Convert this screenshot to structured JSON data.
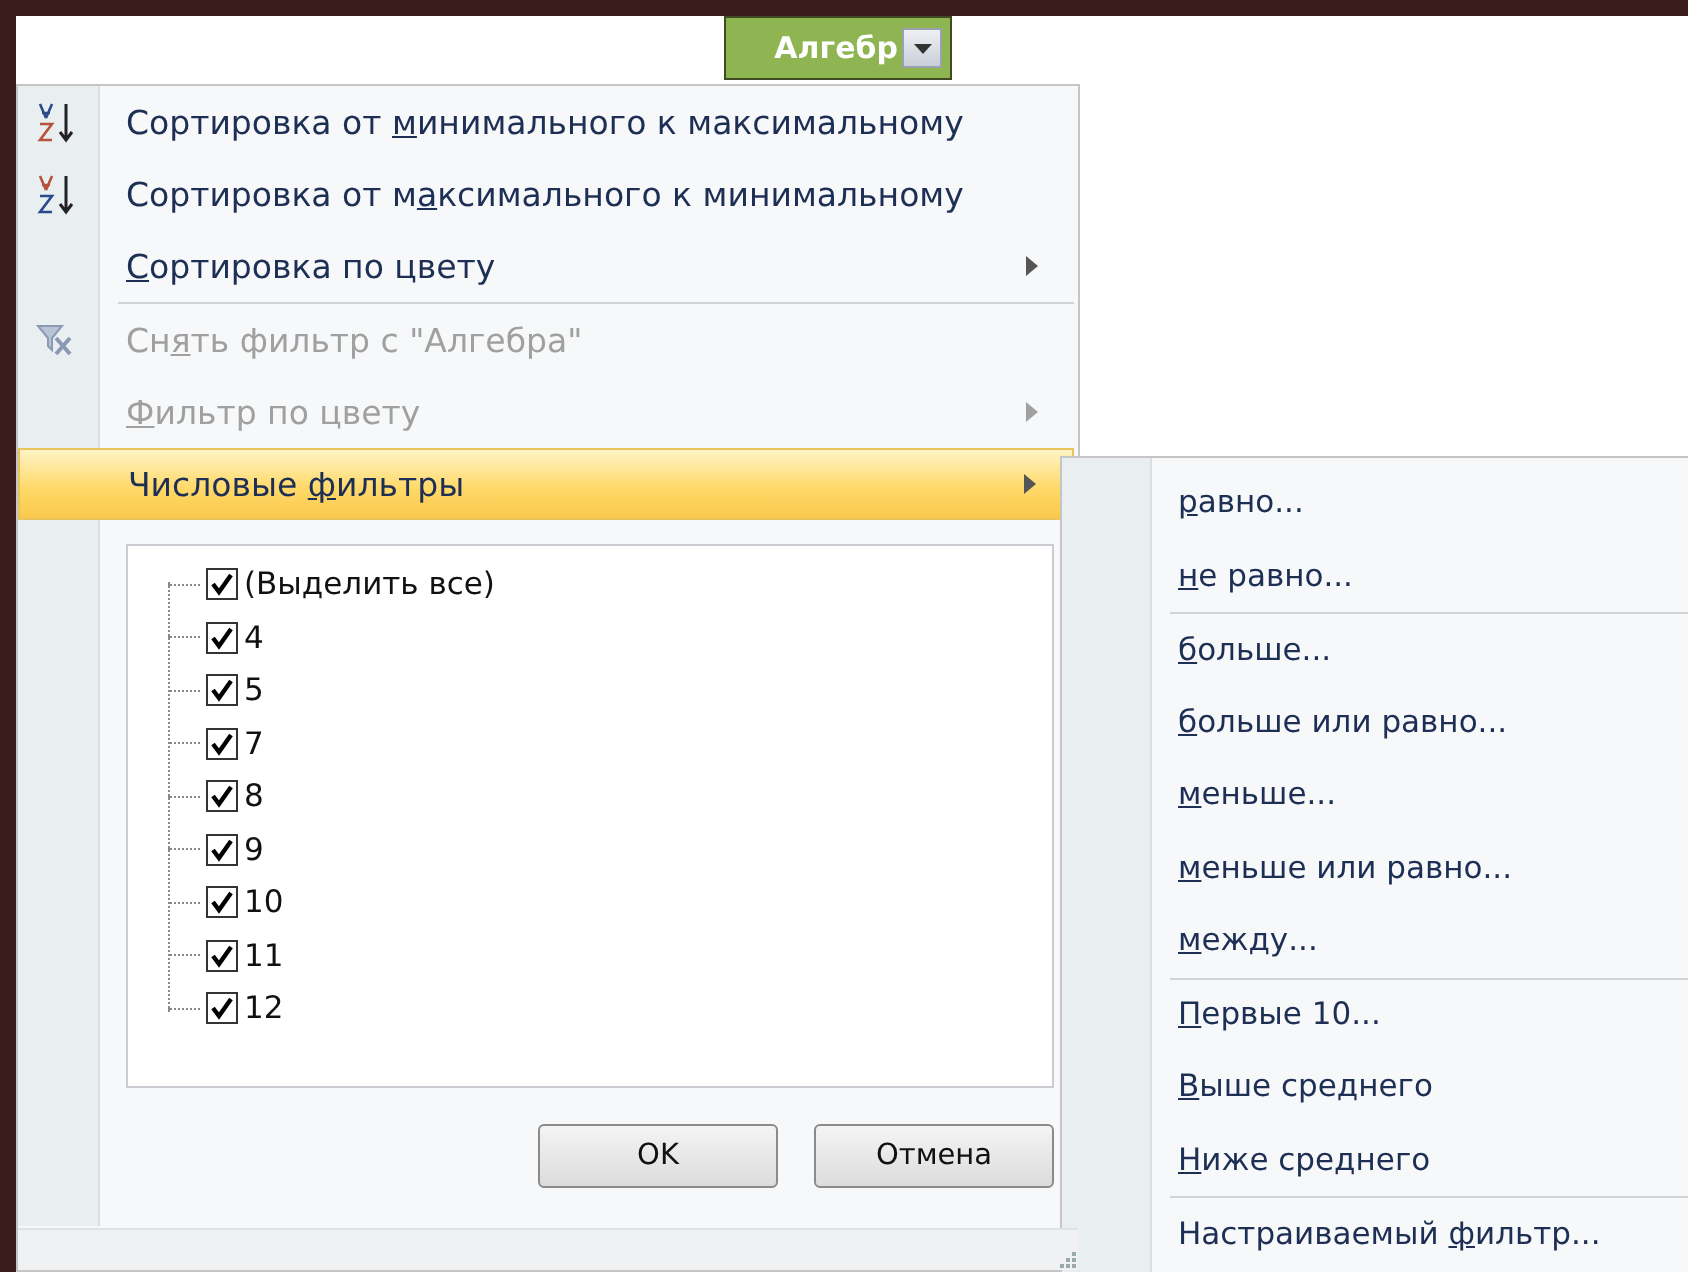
{
  "header_cell": {
    "label": "Алгебр"
  },
  "menu": {
    "items": [
      {
        "kind": "sort-asc",
        "label_parts": {
          "before": "Сортировка от ",
          "key": "м",
          "after": "инимального к максимальному"
        },
        "disabled": false,
        "submenu": false,
        "selected": false,
        "separator_before": false
      },
      {
        "kind": "sort-desc",
        "label_parts": {
          "before": "Сортировка от м",
          "key": "а",
          "after": "ксимального к минимальному"
        },
        "disabled": false,
        "submenu": false,
        "selected": false,
        "separator_before": false
      },
      {
        "kind": "plain",
        "label_parts": {
          "key": "С",
          "after": "ортировка по цвету"
        },
        "disabled": false,
        "submenu": true,
        "selected": false,
        "separator_before": false
      },
      {
        "kind": "clear-filter",
        "label_parts": {
          "before": "Сн",
          "key": "я",
          "after": "ть фильтр с \"Алгебра\""
        },
        "disabled": true,
        "submenu": false,
        "selected": false,
        "separator_before": true
      },
      {
        "kind": "plain",
        "label_parts": {
          "key": "Ф",
          "after": "ильтр по цвету"
        },
        "disabled": true,
        "submenu": true,
        "selected": false,
        "separator_before": false
      },
      {
        "kind": "plain",
        "label_parts": {
          "before": "Числовые ",
          "key": "ф",
          "after": "ильтры"
        },
        "disabled": false,
        "submenu": true,
        "selected": true,
        "separator_before": false
      }
    ]
  },
  "values": [
    {
      "label": "(Выделить все)",
      "checked": true
    },
    {
      "label": "4",
      "checked": true
    },
    {
      "label": "5",
      "checked": true
    },
    {
      "label": "7",
      "checked": true
    },
    {
      "label": "8",
      "checked": true
    },
    {
      "label": "9",
      "checked": true
    },
    {
      "label": "10",
      "checked": true
    },
    {
      "label": "11",
      "checked": true
    },
    {
      "label": "12",
      "checked": true
    }
  ],
  "buttons": [
    "OK",
    "Отмена"
  ],
  "submenu": {
    "items": [
      {
        "label_parts": {
          "key": "р",
          "after": "авно..."
        },
        "separator_before": false
      },
      {
        "label_parts": {
          "key": "н",
          "after": "е равно..."
        },
        "separator_before": false
      },
      {
        "label_parts": {
          "key": "б",
          "after": "ольше..."
        },
        "separator_before": true
      },
      {
        "label_parts": {
          "key": "б",
          "after": "ольше или равно..."
        },
        "separator_before": false
      },
      {
        "label_parts": {
          "key": "м",
          "after": "еньше..."
        },
        "separator_before": false
      },
      {
        "label_parts": {
          "key": "м",
          "after": "еньше или равно..."
        },
        "separator_before": false
      },
      {
        "label_parts": {
          "key": "м",
          "after": "ежду..."
        },
        "separator_before": false
      },
      {
        "label_parts": {
          "key": "П",
          "after": "ервые 10..."
        },
        "separator_before": true
      },
      {
        "label_parts": {
          "key": "В",
          "after": "ыше среднего"
        },
        "separator_before": false
      },
      {
        "label_parts": {
          "key": "Н",
          "after": "иже среднего"
        },
        "separator_before": false
      },
      {
        "label_parts": {
          "before": "Настраиваемый ",
          "key": "ф",
          "after": "ильтр..."
        },
        "separator_before": true
      }
    ]
  }
}
